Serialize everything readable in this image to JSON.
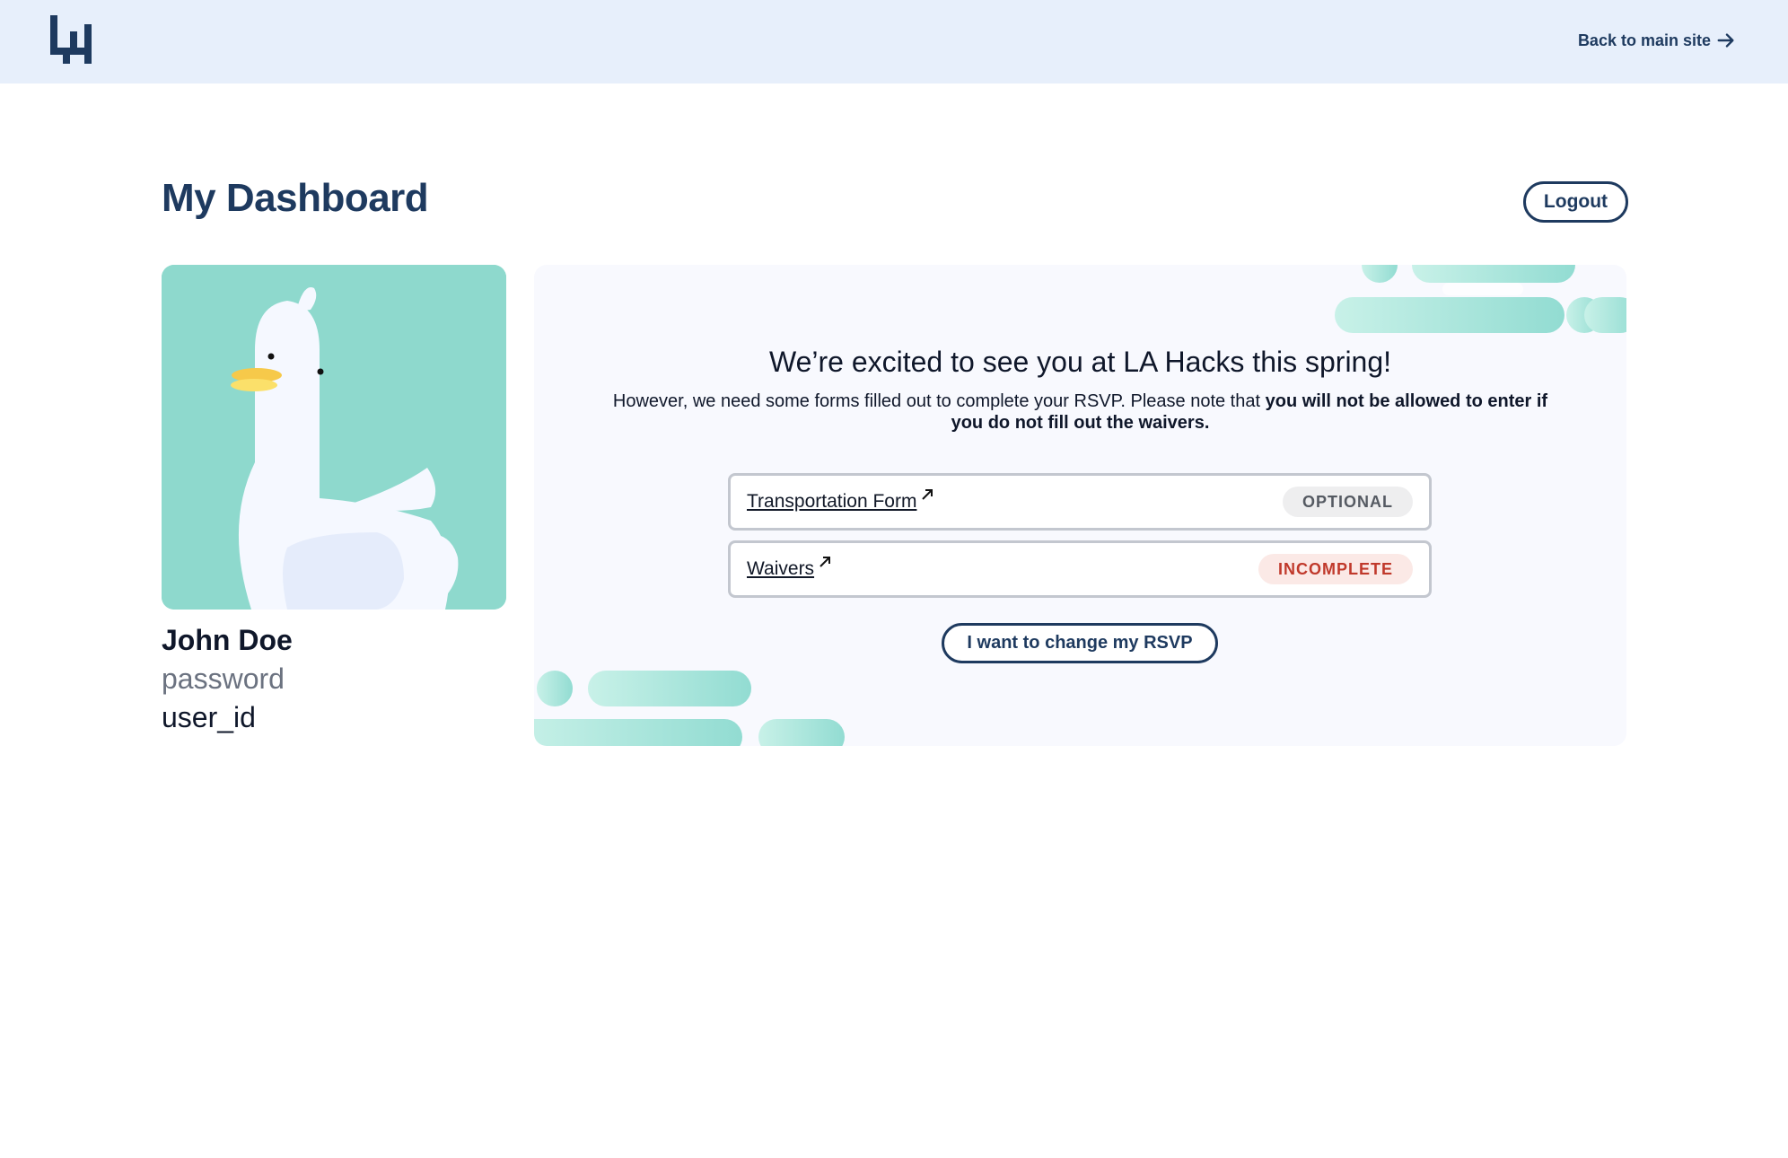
{
  "header": {
    "logo_icon": "la-hacks-logo-icon",
    "back_link_label": "Back to main site",
    "back_link_icon": "arrow-right-icon"
  },
  "page": {
    "title": "My Dashboard",
    "logout_label": "Logout"
  },
  "user": {
    "avatar_icon": "duck-avatar",
    "name": "John Doe",
    "password": "password",
    "user_id": "user_id"
  },
  "rsvp_panel": {
    "heading": "We’re excited to see you at LA Hacks this spring!",
    "text_regular": "However, we need some forms filled out to complete your RSVP. Please note that ",
    "text_bold": "you will not be allowed to enter if you do not fill out the waivers.",
    "forms": [
      {
        "label": "Transportation Form",
        "status": "OPTIONAL",
        "icon": "external-link-icon"
      },
      {
        "label": "Waivers",
        "status": "INCOMPLETE",
        "icon": "external-link-icon"
      }
    ],
    "change_rsvp_label": "I want to change my RSVP"
  },
  "colors": {
    "header_bg": "#e7effb",
    "brand_navy": "#1e3a5f",
    "avatar_bg": "#8ed9cd",
    "panel_bg": "#f8f9fe",
    "badge_optional_bg": "#eeeeef",
    "badge_incomplete_bg": "#fbe9e6",
    "badge_incomplete_text": "#c0392b"
  }
}
